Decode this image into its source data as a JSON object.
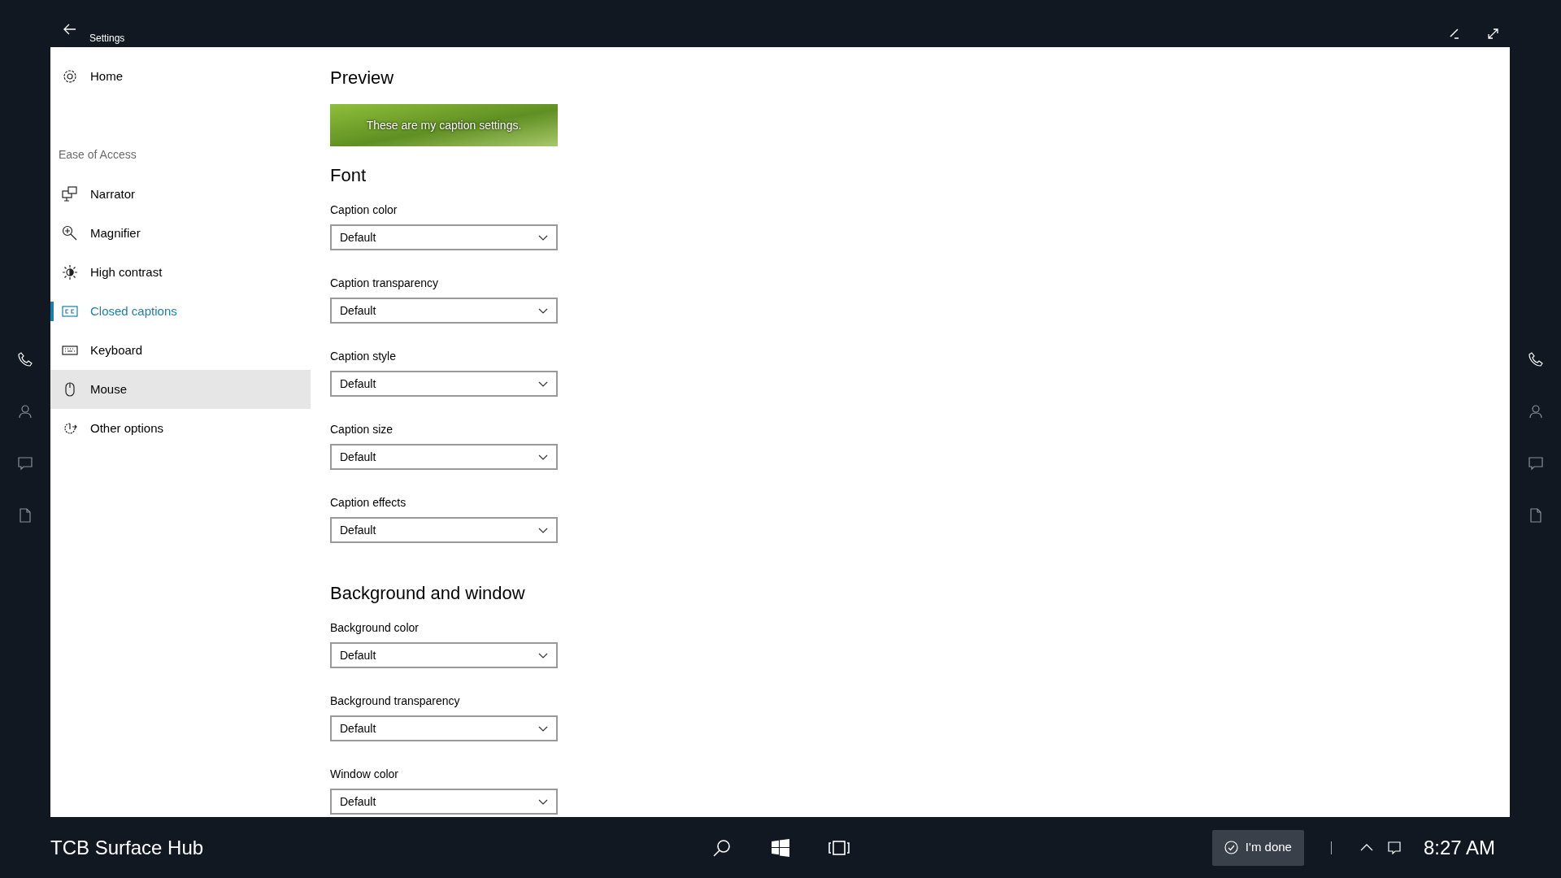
{
  "window": {
    "title": "Settings"
  },
  "sidebar": {
    "home": "Home",
    "section": "Ease of Access",
    "items": [
      {
        "label": "Narrator",
        "kind": "narrator",
        "selected": false,
        "hovered": false
      },
      {
        "label": "Magnifier",
        "kind": "magnifier",
        "selected": false,
        "hovered": false
      },
      {
        "label": "High contrast",
        "kind": "contrast",
        "selected": false,
        "hovered": false
      },
      {
        "label": "Closed captions",
        "kind": "captions",
        "selected": true,
        "hovered": false
      },
      {
        "label": "Keyboard",
        "kind": "keyboard",
        "selected": false,
        "hovered": false
      },
      {
        "label": "Mouse",
        "kind": "mouse",
        "selected": false,
        "hovered": true
      },
      {
        "label": "Other options",
        "kind": "other",
        "selected": false,
        "hovered": false
      }
    ]
  },
  "preview": {
    "heading": "Preview",
    "caption": "These are my caption settings."
  },
  "sections": [
    {
      "heading": "Font",
      "fields": [
        {
          "label": "Caption color",
          "value": "Default"
        },
        {
          "label": "Caption transparency",
          "value": "Default"
        },
        {
          "label": "Caption style",
          "value": "Default"
        },
        {
          "label": "Caption size",
          "value": "Default"
        },
        {
          "label": "Caption effects",
          "value": "Default"
        }
      ]
    },
    {
      "heading": "Background and window",
      "fields": [
        {
          "label": "Background color",
          "value": "Default"
        },
        {
          "label": "Background transparency",
          "value": "Default"
        },
        {
          "label": "Window color",
          "value": "Default"
        }
      ]
    }
  ],
  "taskbar": {
    "device_name": "TCB Surface Hub",
    "done_button": "I'm done",
    "time": "8:27 AM"
  }
}
